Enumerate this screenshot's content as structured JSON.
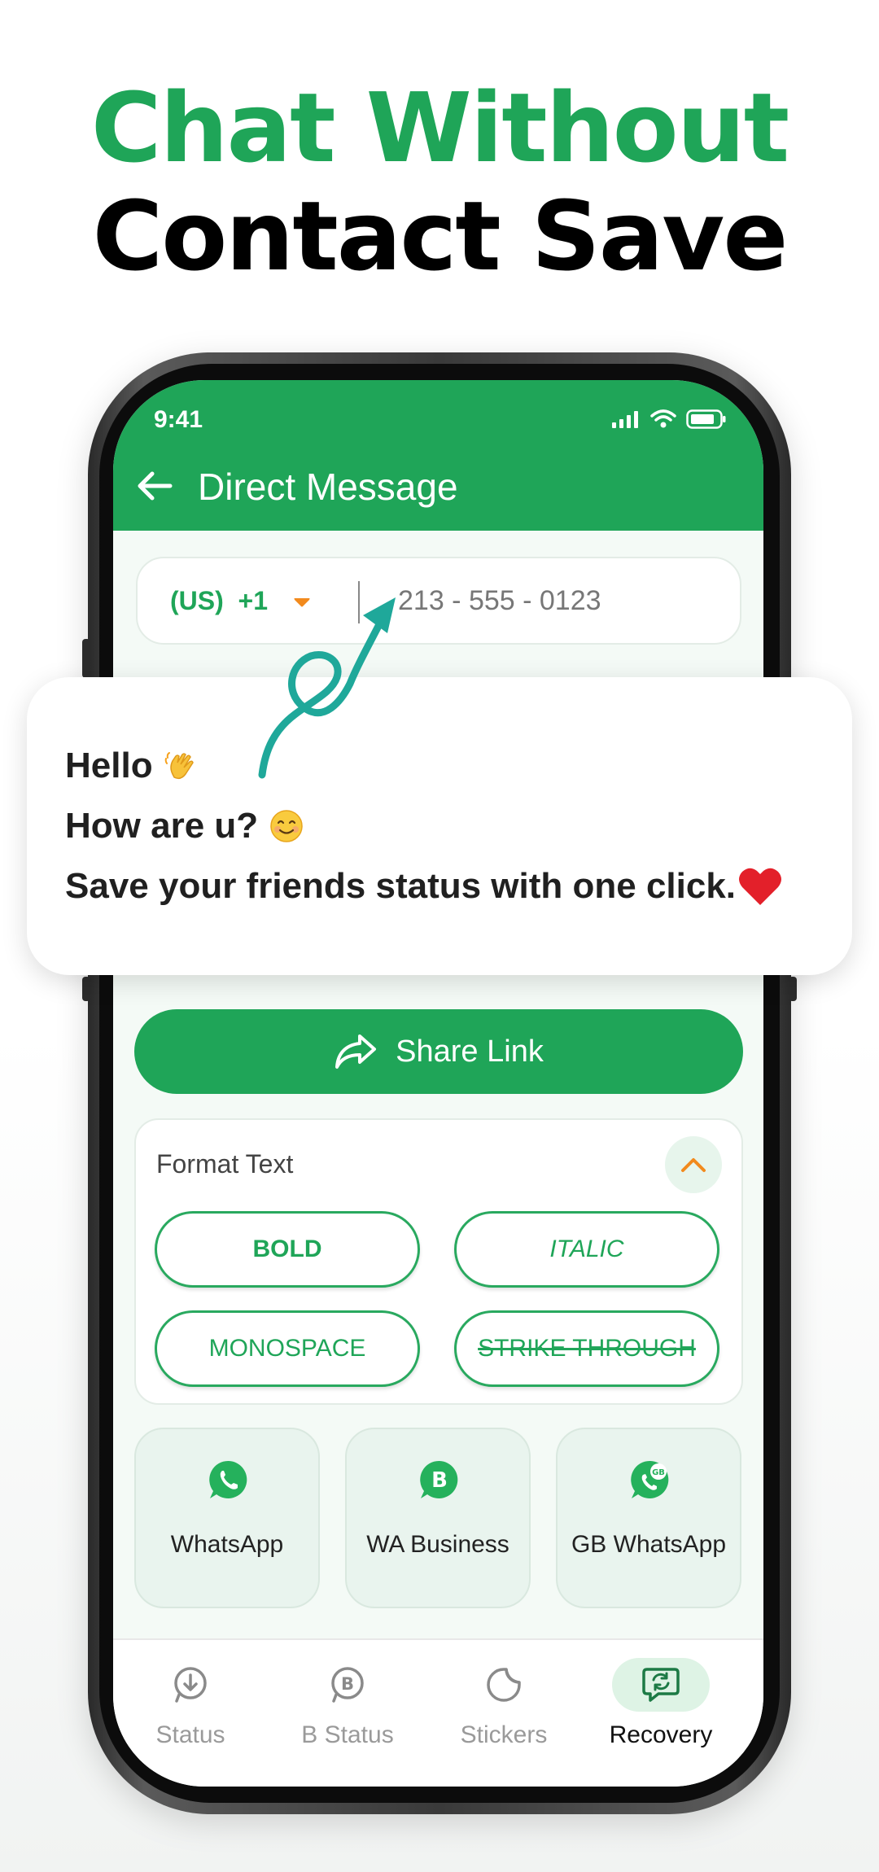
{
  "promo": {
    "headline_line1": "Chat Without",
    "headline_line2": "Contact Save",
    "colors": {
      "accent": "#1fa558",
      "dark": "#000000"
    }
  },
  "status_bar": {
    "time": "9:41"
  },
  "app_bar": {
    "title": "Direct Message"
  },
  "phone_input": {
    "country_code": "(US)  +1",
    "number": "213 - 555 - 0123"
  },
  "message_preview": {
    "line1": "Hello",
    "line2": "How are u?",
    "line3": "Save your friends status with one click."
  },
  "share_button": {
    "label": "Share Link"
  },
  "format_text": {
    "title": "Format Text",
    "options": [
      "BOLD",
      "ITALIC",
      "MONOSPACE",
      "STRIKE THROUGH"
    ]
  },
  "apps": [
    {
      "label": "WhatsApp",
      "icon": "whatsapp-icon"
    },
    {
      "label": "WA Business",
      "icon": "wa-business-icon"
    },
    {
      "label": "GB WhatsApp",
      "icon": "gb-whatsapp-icon"
    }
  ],
  "bottom_nav": {
    "items": [
      {
        "label": "Status",
        "icon": "download-status-icon"
      },
      {
        "label": "B Status",
        "icon": "business-status-icon"
      },
      {
        "label": "Stickers",
        "icon": "sticker-icon"
      },
      {
        "label": "Recovery",
        "icon": "recovery-chat-icon"
      }
    ],
    "active": "Recovery"
  }
}
